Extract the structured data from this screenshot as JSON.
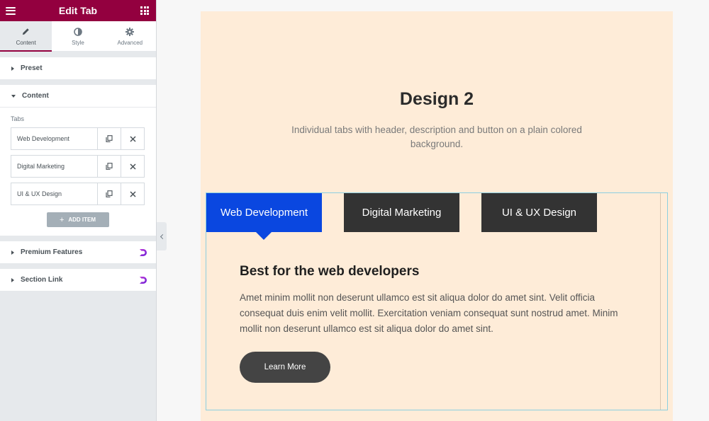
{
  "panel": {
    "title": "Edit Tab",
    "tabs": [
      {
        "label": "Content",
        "icon": "pencil-icon"
      },
      {
        "label": "Style",
        "icon": "contrast-icon"
      },
      {
        "label": "Advanced",
        "icon": "gear-icon"
      }
    ],
    "sections": {
      "preset": "Preset",
      "content": "Content",
      "premium_features": "Premium Features",
      "section_link": "Section Link"
    },
    "tabs_label": "Tabs",
    "repeater_items": [
      "Web Development",
      "Digital Marketing",
      "UI & UX Design"
    ],
    "add_item_label": "ADD ITEM",
    "add_item_plus": "+"
  },
  "preview": {
    "heading": "Design 2",
    "subtext": "Individual tabs with header, description and button on a plain colored background.",
    "tab_headers": [
      "Web Development",
      "Digital Marketing",
      "UI & UX Design"
    ],
    "active_tab": 0,
    "pane_title": "Best for the web developers",
    "pane_text": "Amet minim mollit non deserunt ullamco est sit aliqua dolor do amet sint. Velit officia consequat duis enim velit mollit. Exercitation veniam consequat sunt nostrud amet. Minim mollit non deserunt ullamco est sit aliqua dolor do amet sint.",
    "button_label": "Learn More"
  },
  "colors": {
    "brand": "#93003f",
    "active_tab": "#0a47e0",
    "inactive_tab": "#333333",
    "preview_bg": "#feecd8",
    "button": "#444444"
  }
}
